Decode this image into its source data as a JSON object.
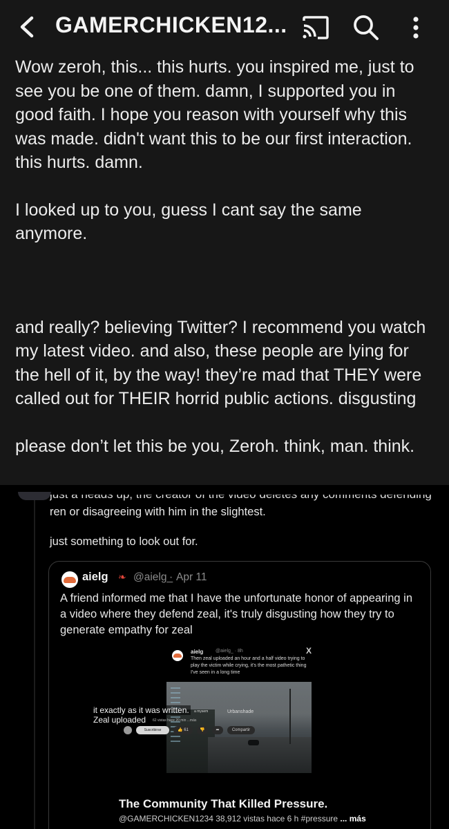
{
  "header": {
    "title": "GAMERCHICKEN12...",
    "icons": [
      "back-icon",
      "cast-icon",
      "search-icon",
      "more-vertical-icon"
    ]
  },
  "post": {
    "paragraphs": [
      "Wow zeroh, this... this hurts. you inspired me, just to see you be one of them. damn, I supported you in good faith. I hope you reason with yourself why this was made. didn't want this to be our first interaction. this hurts. damn.",
      "I looked up to you, guess I cant say the same anymore.",
      "and really? believing Twitter? I recommend you watch my latest video. and also, these people are lying for the hell of it, by the way! they’re mad that THEY were called out for THEIR horrid public actions. disgusting",
      "please don’t let this be you, Zeroh. think, man. think."
    ]
  },
  "screenshot": {
    "cut_line": "just a heads up, the creator of the video deletes any comments defending",
    "reply_line1": "ren or disagreeing with him in the slightest.",
    "reply_line2": "just something to look out for.",
    "quote": {
      "name": "aielg",
      "handle": "@aielg_",
      "separator": "·",
      "date": "Apr 11",
      "text": "A friend informed me that I have the unfortunate honor of appearing in a video where they defend zeal, it's truly disgusting how they try to generate empathy for zeal"
    },
    "nested": {
      "name": "aielg",
      "meta": "@aielg_ · 8h",
      "close": "X",
      "text": "Then zeal uploaded an hour and a half video trying to play the victim while crying, it's the most pathetic thing I've seen in a long time"
    },
    "video": {
      "caption1": "it exactly as it was written.",
      "caption_overlap1": "a mysem",
      "caption_overlap2": "Urbanshade",
      "caption2": "Zeal uploaded",
      "caption_meta": "62 vistas hace 20 min ...más",
      "subscribe": "Suscribirse",
      "likes": "61",
      "share_label": "Compartir",
      "title": "The Community That Killed Pressure.",
      "channel": "@GAMERCHICKEN1234",
      "views": "38,912 vistas hace 6 h",
      "hashtag": "#pressure",
      "more": "... más"
    }
  }
}
